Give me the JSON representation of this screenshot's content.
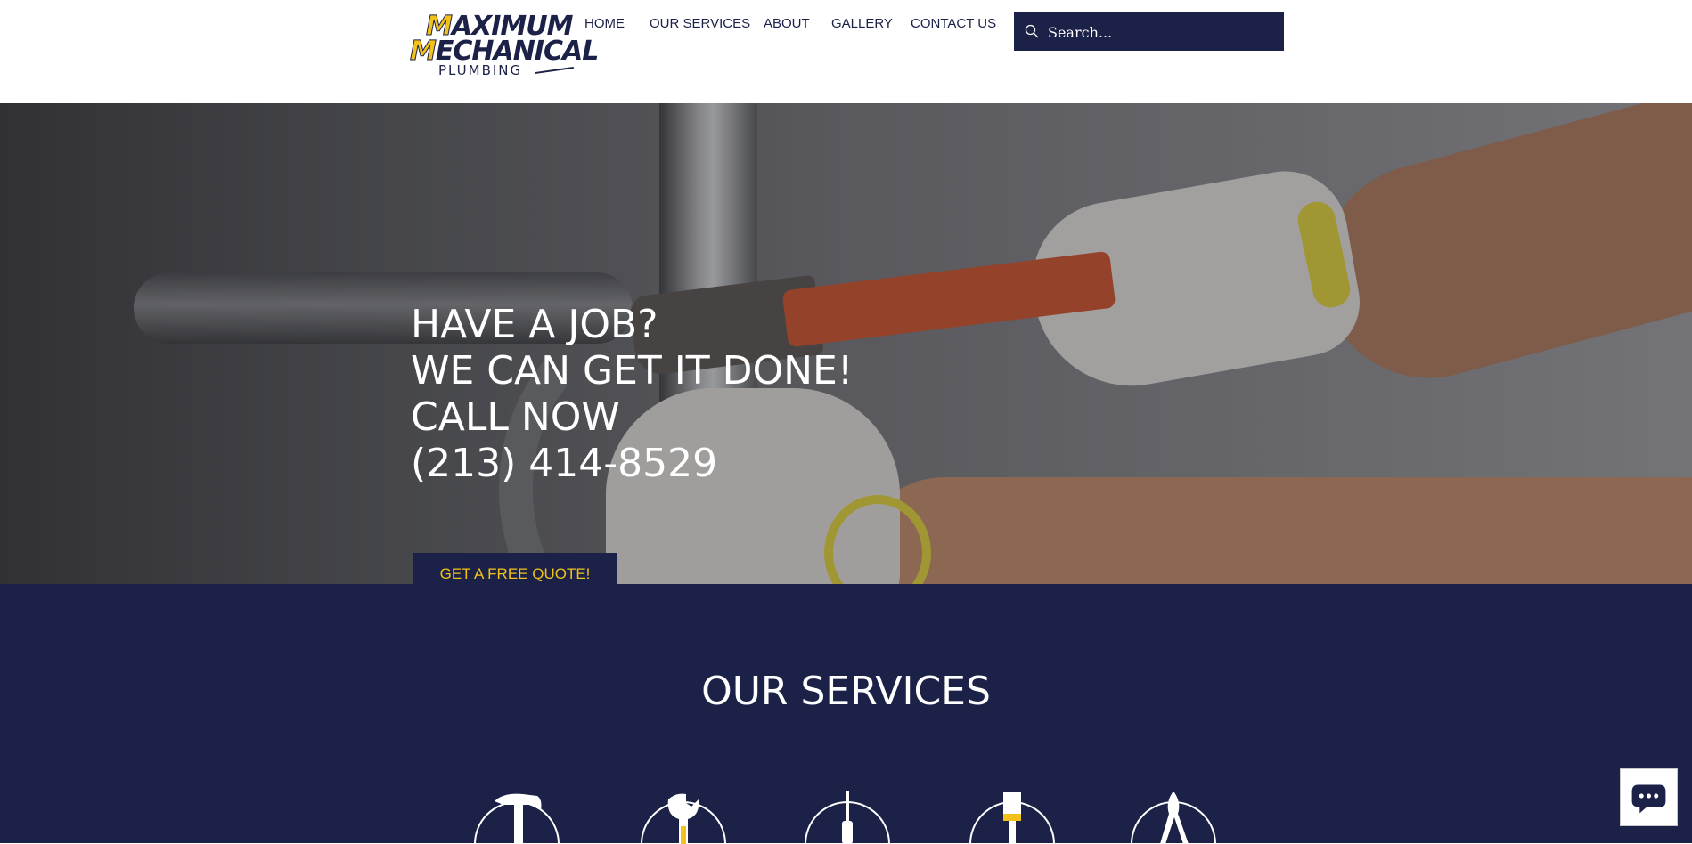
{
  "logo": {
    "line1": "AXIMUM",
    "line2": "ECHANICAL",
    "line3": "PLUMBING",
    "cap1": "M",
    "cap2": "M"
  },
  "nav": {
    "items": [
      "HOME",
      "OUR SERVICES",
      "ABOUT",
      "GALLERY",
      "CONTACT US"
    ]
  },
  "search": {
    "placeholder": "Search..."
  },
  "hero": {
    "lines": [
      "HAVE A JOB?",
      "WE CAN GET IT DONE!",
      "CALL NOW",
      "(213) 414-8529"
    ],
    "cta": "GET A FREE QUOTE!"
  },
  "services": {
    "title": "OUR SERVICES"
  },
  "icons": {
    "search": "search-icon",
    "scroll": "chevron-down-icon",
    "chat": "chat-icon",
    "services": [
      "hammer-icon",
      "wrench-icon",
      "screwdriver-icon",
      "paint-brush-icon",
      "pliers-icon"
    ]
  },
  "colors": {
    "navy": "#1b2147",
    "gold": "#f2c21a",
    "white": "#ffffff"
  }
}
